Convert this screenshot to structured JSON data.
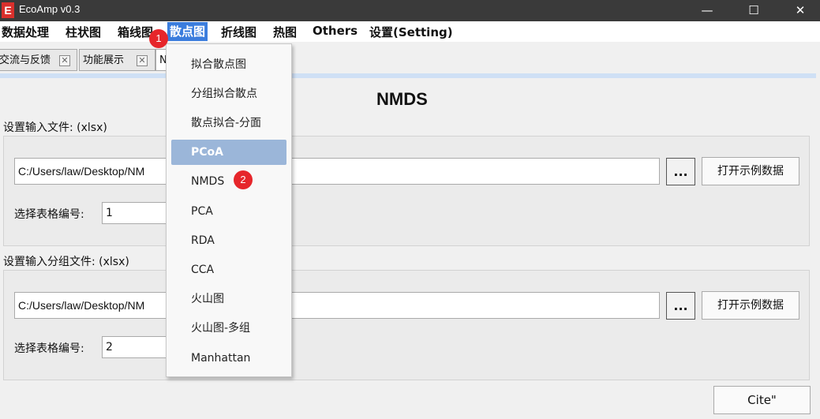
{
  "window": {
    "title": "EcoAmp v0.3",
    "icon_letter": "E",
    "minimize": "—",
    "maximize": "☐",
    "close": "✕"
  },
  "menubar": [
    "数据处理",
    "柱状图",
    "箱线图",
    "散点图",
    "折线图",
    "热图",
    "Others",
    "设置(Setting)"
  ],
  "tabs": [
    {
      "label": "交流与反馈",
      "close": "✕"
    },
    {
      "label": "功能展示",
      "close": "✕"
    },
    {
      "label": "N"
    }
  ],
  "page": {
    "title": "NMDS"
  },
  "input_file": {
    "label": "设置输入文件: (xlsx)",
    "path": "C:/Users/law/Desktop/NM",
    "browse": "...",
    "example": "打开示例数据",
    "sheet_label": "选择表格编号:",
    "sheet_value": "1"
  },
  "group_file": {
    "label": "设置输入分组文件: (xlsx)",
    "path": "C:/Users/law/Desktop/NM",
    "browse": "...",
    "example": "打开示例数据",
    "sheet_label": "选择表格编号:",
    "sheet_value": "2"
  },
  "cite": "Cite\"",
  "dropdown": {
    "items": [
      "拟合散点图",
      "分组拟合散点",
      "散点拟合-分面",
      "PCoA",
      "NMDS",
      "PCA",
      "RDA",
      "CCA",
      "火山图",
      "火山图-多组",
      "Manhattan"
    ],
    "highlighted": "PCoA"
  },
  "badges": [
    "1",
    "2"
  ],
  "colors": {
    "titlebar": "#3a3a3a",
    "accent": "#3b7ddd",
    "badge": "#e6262b",
    "highlight": "#9bb6d9",
    "app_icon": "#d9302c"
  }
}
